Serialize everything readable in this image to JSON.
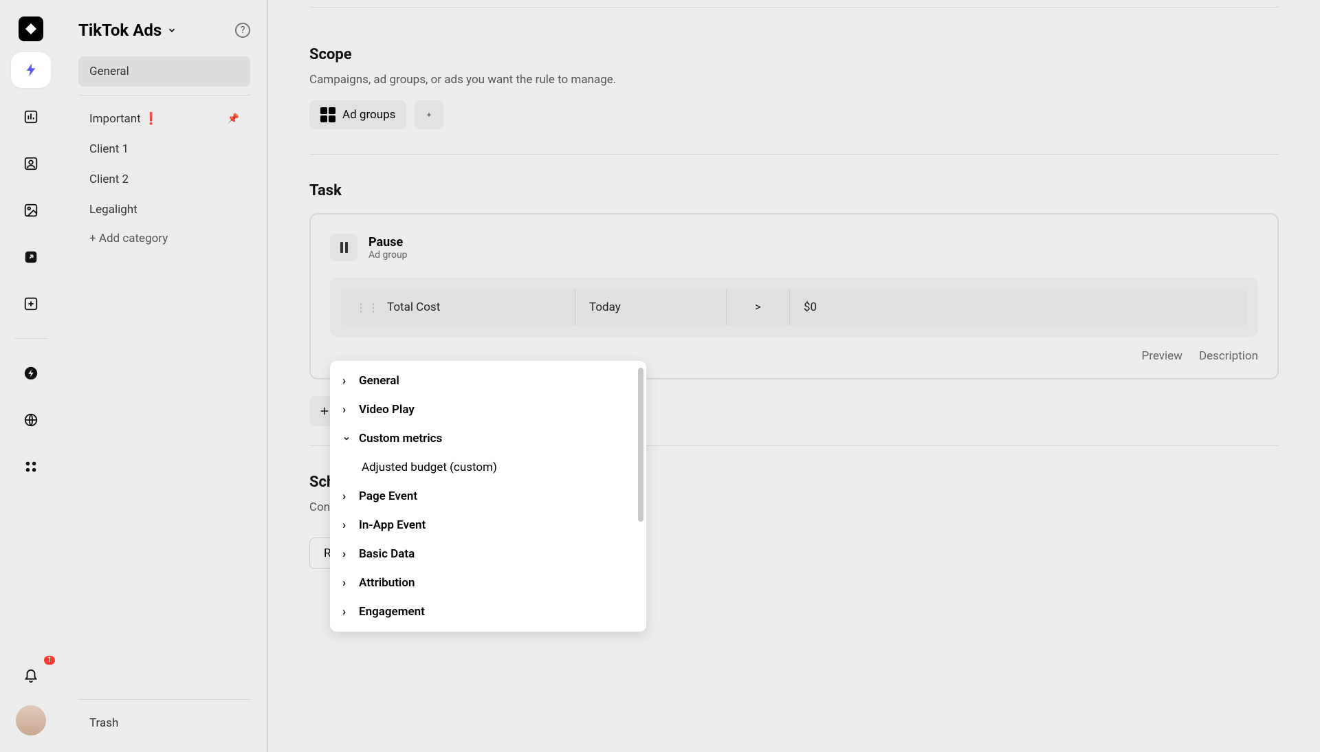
{
  "rail": {
    "notification_count": "1"
  },
  "sidebar": {
    "title": "TikTok Ads",
    "items_primary": [
      {
        "label": "General",
        "active": true
      }
    ],
    "items": [
      {
        "label": "Important",
        "emoji": "❗",
        "pinned": true
      },
      {
        "label": "Client 1"
      },
      {
        "label": "Client 2"
      },
      {
        "label": "Legalight"
      }
    ],
    "add_category": "+ Add category",
    "trash": "Trash"
  },
  "scope": {
    "title": "Scope",
    "desc": "Campaigns, ad groups, or ads you want the rule to manage.",
    "chip_label": "Ad groups"
  },
  "task": {
    "title": "Task",
    "action_title": "Pause",
    "action_sub": "Ad group",
    "condition": {
      "metric": "Total Cost",
      "period": "Today",
      "op": ">",
      "value": "$0"
    },
    "dropdown": {
      "groups": [
        {
          "label": "General",
          "expanded": false
        },
        {
          "label": "Video Play",
          "expanded": false
        },
        {
          "label": "Custom metrics",
          "expanded": true,
          "children": [
            "Adjusted budget (custom)"
          ]
        },
        {
          "label": "Page Event",
          "expanded": false
        },
        {
          "label": "In-App Event",
          "expanded": false
        },
        {
          "label": "Basic Data",
          "expanded": false
        },
        {
          "label": "Attribution",
          "expanded": false
        },
        {
          "label": "Engagement",
          "expanded": false
        }
      ]
    },
    "preview": "Preview",
    "description": "Description"
  },
  "schedule": {
    "title_partial": "Sch",
    "desc_partial": "Con",
    "run_partial": "Ru"
  }
}
